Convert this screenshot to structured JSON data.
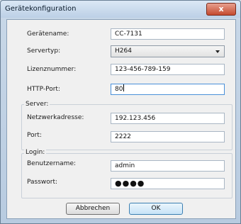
{
  "window": {
    "title": "Gerätekonfiguration",
    "close_label": "x"
  },
  "device": {
    "name_label": "Gerätename:",
    "name_value": "CC-7131",
    "server_type_label": "Servertyp:",
    "server_type_value": "H264",
    "license_label": "Lizenznummer:",
    "license_value": "123-456-789-159",
    "http_port_label": "HTTP-Port:",
    "http_port_value": "80"
  },
  "server": {
    "group_label": "Server:",
    "address_label": "Netzwerkadresse:",
    "address_value": "192.123.456",
    "port_label": "Port:",
    "port_value": "2222"
  },
  "login": {
    "group_label": "Login:",
    "username_label": "Benutzername:",
    "username_value": "admin",
    "password_label": "Passwort:",
    "password_value": "●●●●"
  },
  "buttons": {
    "cancel_label": "Abbrechen",
    "ok_label": "OK"
  }
}
